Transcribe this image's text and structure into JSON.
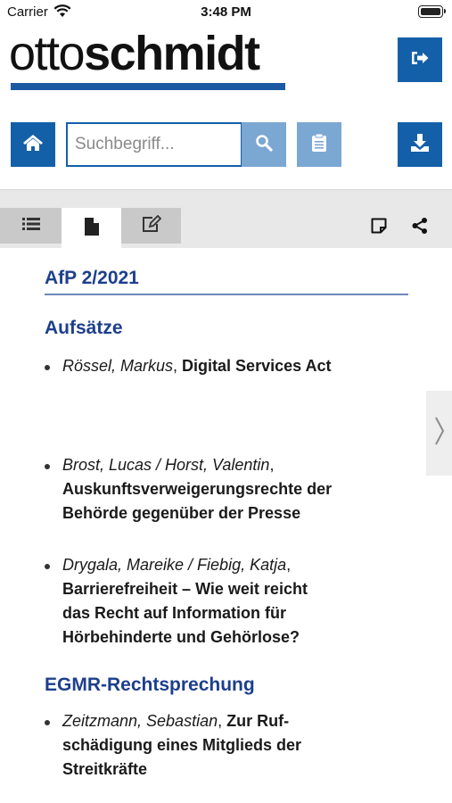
{
  "status_bar": {
    "carrier": "Carrier",
    "time": "3:48 PM"
  },
  "logo": {
    "light": "otto",
    "bold": "schmidt"
  },
  "search": {
    "placeholder": "Suchbegriff..."
  },
  "icons": {
    "logout": "logout-icon",
    "home": "home-icon",
    "search": "search-icon",
    "clipboard": "clipboard-icon",
    "download": "download-icon",
    "list": "list-icon",
    "document": "document-icon",
    "edit": "edit-icon",
    "note": "note-icon",
    "share": "share-icon",
    "next": "chevron-right-icon"
  },
  "colors": {
    "brand_blue": "#1460a8",
    "brand_blue_light": "#7ba7d3",
    "heading_blue": "#1d3f8c"
  },
  "content": {
    "issue_title": "AfP 2/2021",
    "sections": [
      {
        "heading": "Aufsätze",
        "items": [
          {
            "author": "Rössel, Markus",
            "title": "Digital Services Act"
          },
          {
            "author": "Brost, Lucas / Horst, Valentin",
            "title": "Auskunftsverweigerungsrechte der Behörde gegenüber der Presse"
          },
          {
            "author": "Drygala, Mareike / Fiebig, Katja",
            "title": "Barrierefreiheit – Wie weit reicht das Recht auf Information für Hörbehinderte und Gehörlose?"
          }
        ]
      },
      {
        "heading": "EGMR-Rechtsprechung",
        "items": [
          {
            "author": "Zeitzmann, Sebastian",
            "title": "Zur Ruf­schädigung eines Mitglieds der Streitkräfte"
          }
        ]
      }
    ]
  }
}
